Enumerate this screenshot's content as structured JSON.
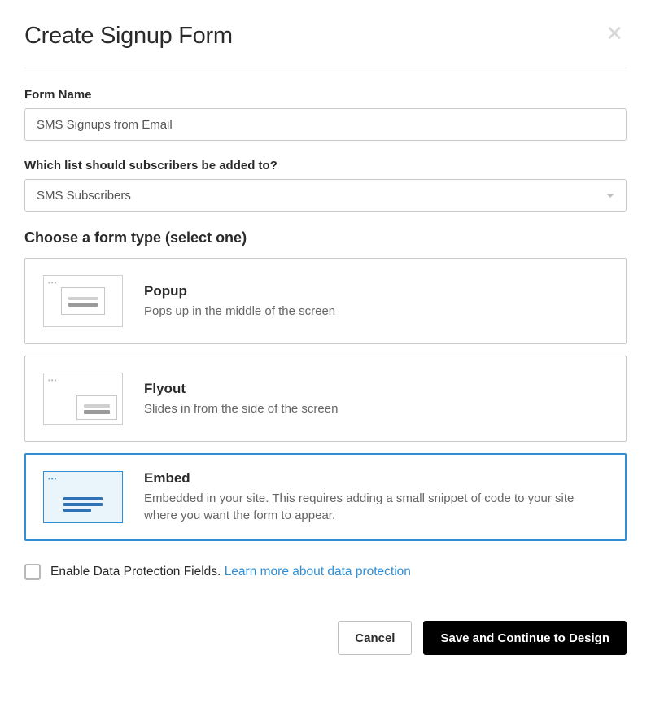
{
  "modal": {
    "title": "Create Signup Form",
    "formName": {
      "label": "Form Name",
      "value": "SMS Signups from Email"
    },
    "listSelect": {
      "label": "Which list should subscribers be added to?",
      "value": "SMS Subscribers"
    },
    "typeSection": {
      "heading": "Choose a form type (select one)",
      "options": [
        {
          "title": "Popup",
          "desc": "Pops up in the middle of the screen",
          "selected": false
        },
        {
          "title": "Flyout",
          "desc": "Slides in from the side of the screen",
          "selected": false
        },
        {
          "title": "Embed",
          "desc": "Embedded in your site. This requires adding a small snippet of code to your site where you want the form to appear.",
          "selected": true
        }
      ]
    },
    "dataProtection": {
      "label": "Enable Data Protection Fields.",
      "linkText": "Learn more about data protection",
      "checked": false
    },
    "footer": {
      "cancel": "Cancel",
      "save": "Save and Continue to Design"
    }
  }
}
